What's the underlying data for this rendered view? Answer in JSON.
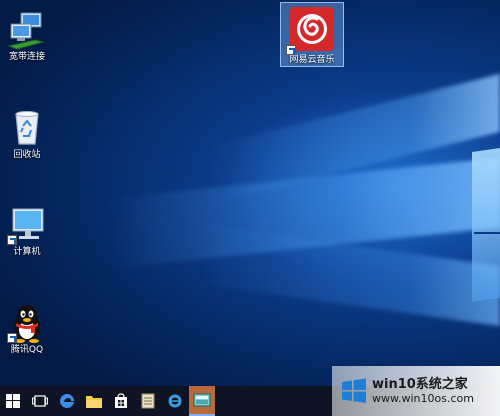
{
  "desktop": {
    "icons": [
      {
        "label": "宽带连接",
        "icon": "network-computers-icon",
        "shortcut": false
      },
      {
        "label": "回收站",
        "icon": "recycle-bin-icon",
        "shortcut": false
      },
      {
        "label": "计算机",
        "icon": "monitor-icon",
        "shortcut": true
      },
      {
        "label": "腾讯QQ",
        "icon": "qq-penguin-icon",
        "shortcut": true
      },
      {
        "label": "网易云音乐",
        "icon": "netease-music-icon",
        "shortcut": true,
        "selected": true
      }
    ]
  },
  "taskbar": {
    "buttons": [
      {
        "icon": "windows-start-icon"
      },
      {
        "icon": "task-view-icon"
      },
      {
        "icon": "edge-browser-icon"
      },
      {
        "icon": "file-explorer-icon"
      },
      {
        "icon": "store-icon"
      },
      {
        "icon": "notepad-icon"
      },
      {
        "icon": "ie-browser-icon"
      },
      {
        "icon": "image-viewer-icon",
        "active": true
      }
    ]
  },
  "watermark": {
    "title": "win10系统之家",
    "url": "www.win10os.com"
  },
  "colors": {
    "taskbar": "#0e1424",
    "wallpaper_dark": "#062a66",
    "wallpaper_light": "#1f6fd0",
    "netease_red": "#d4282b",
    "selection": "#78aae6"
  }
}
